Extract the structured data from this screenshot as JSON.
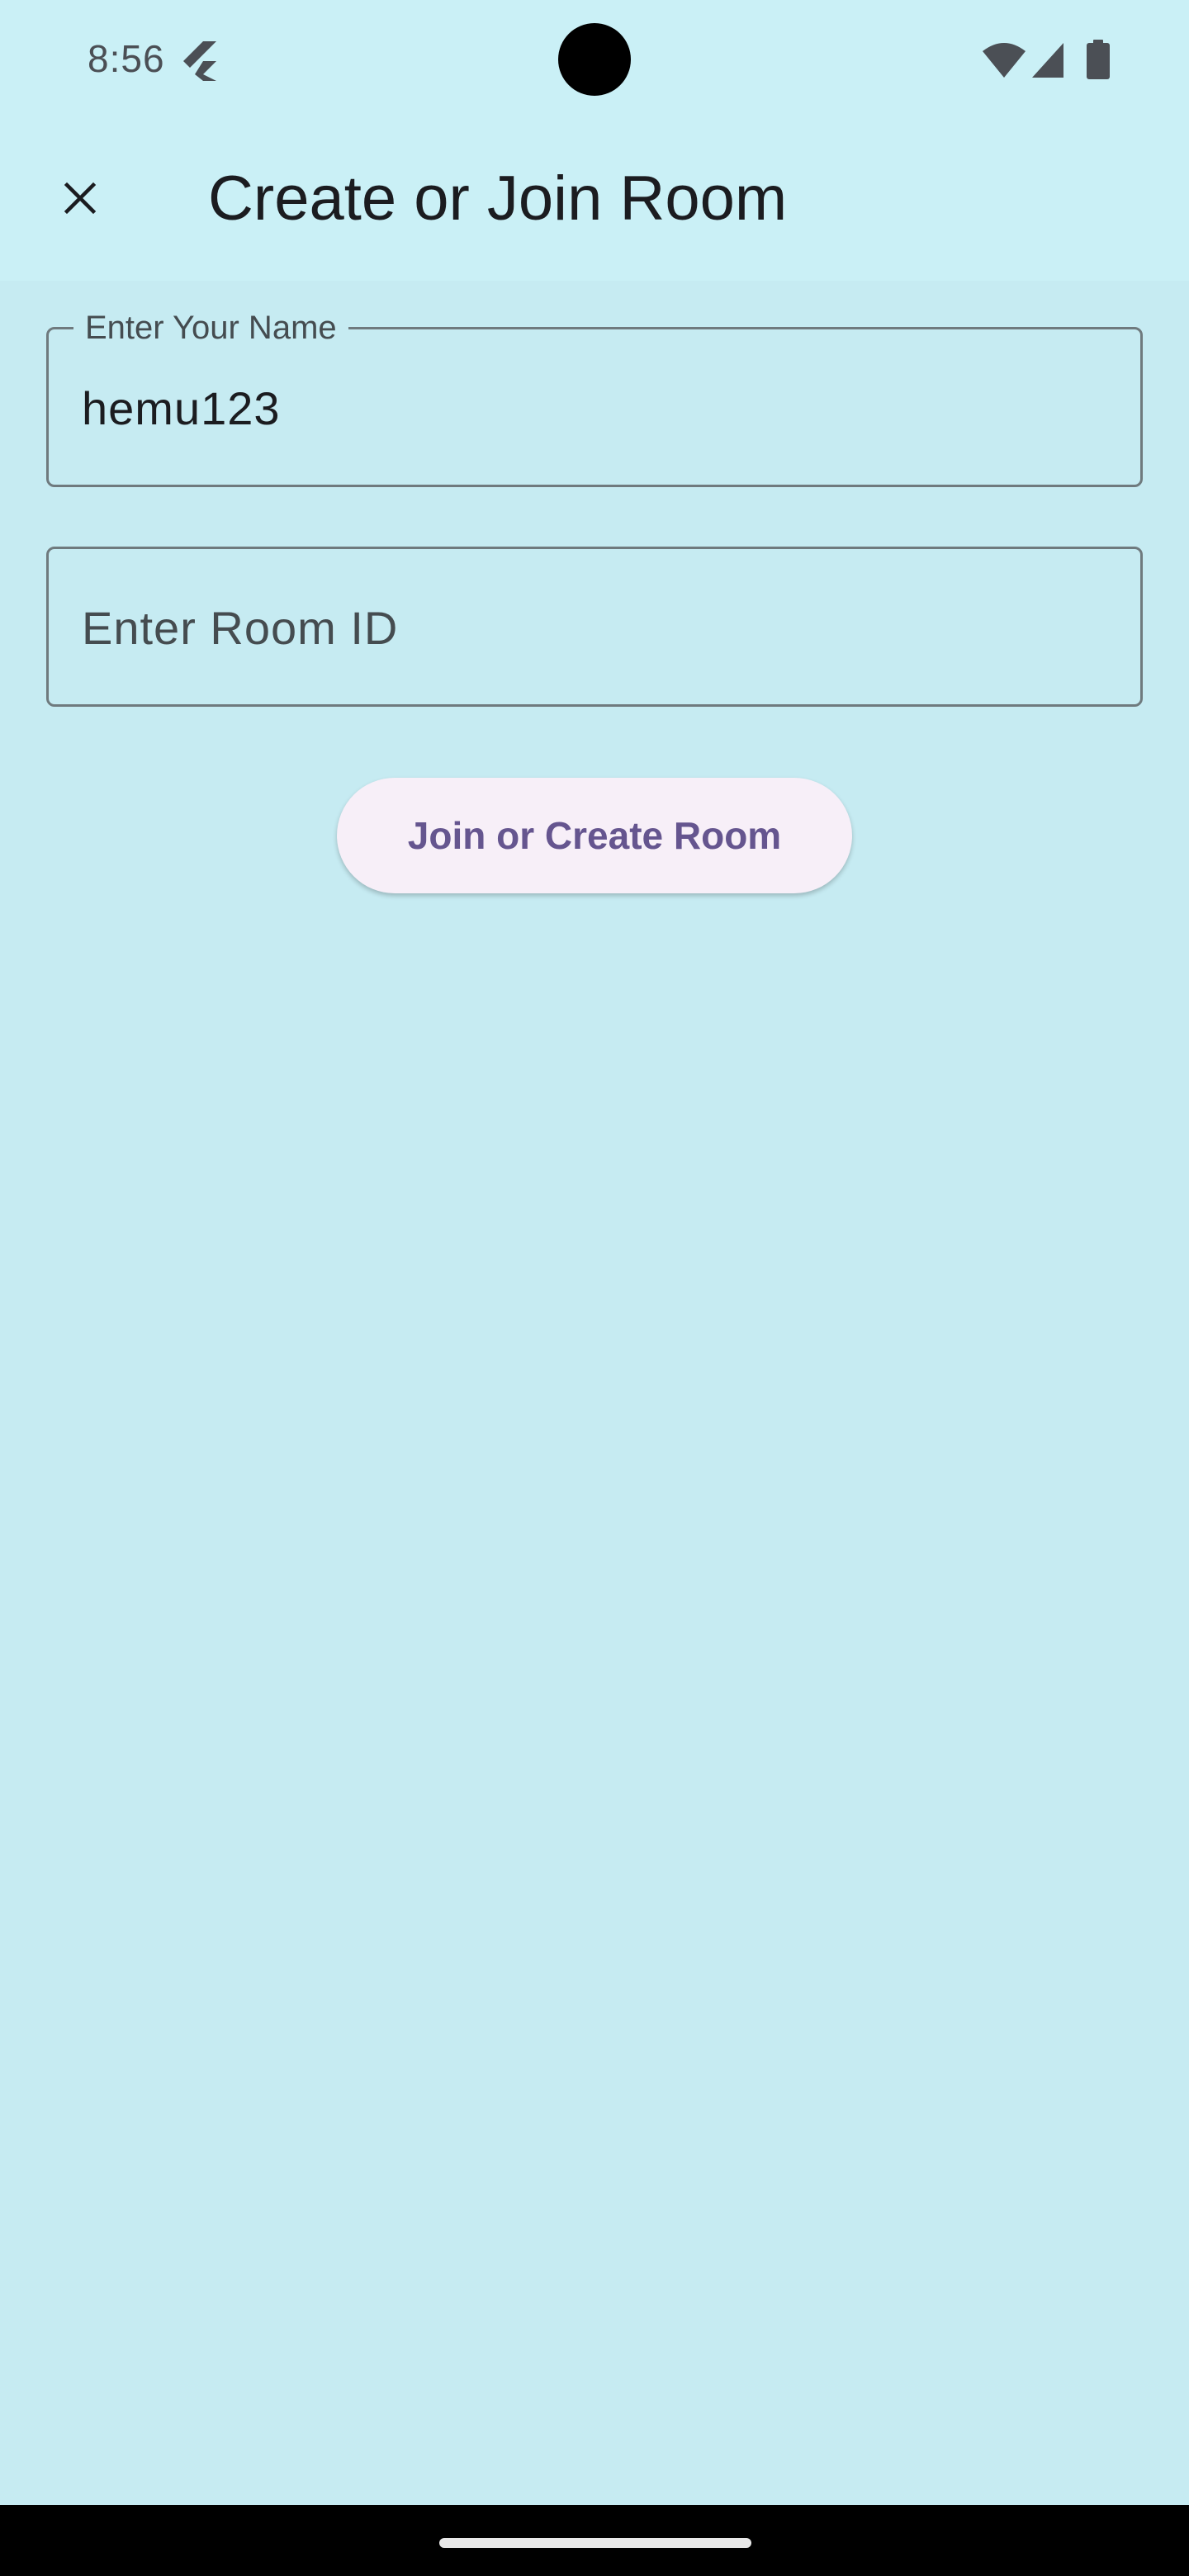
{
  "status_bar": {
    "time": "8:56",
    "icons": [
      "flutter-app-icon",
      "wifi-icon",
      "signal-icon",
      "battery-icon"
    ]
  },
  "app_bar": {
    "title": "Create or Join Room",
    "close_icon": "close-icon"
  },
  "form": {
    "name_field": {
      "label": "Enter Your Name",
      "value": "hemu123"
    },
    "room_field": {
      "placeholder": "Enter Room ID",
      "value": ""
    },
    "submit_label": "Join or Create Room"
  },
  "colors": {
    "background": "#c6ebf2",
    "app_bar": "#caf0f6",
    "button_background": "#f7eff8",
    "button_text": "#65558f",
    "outline": "#6f7a7e"
  }
}
